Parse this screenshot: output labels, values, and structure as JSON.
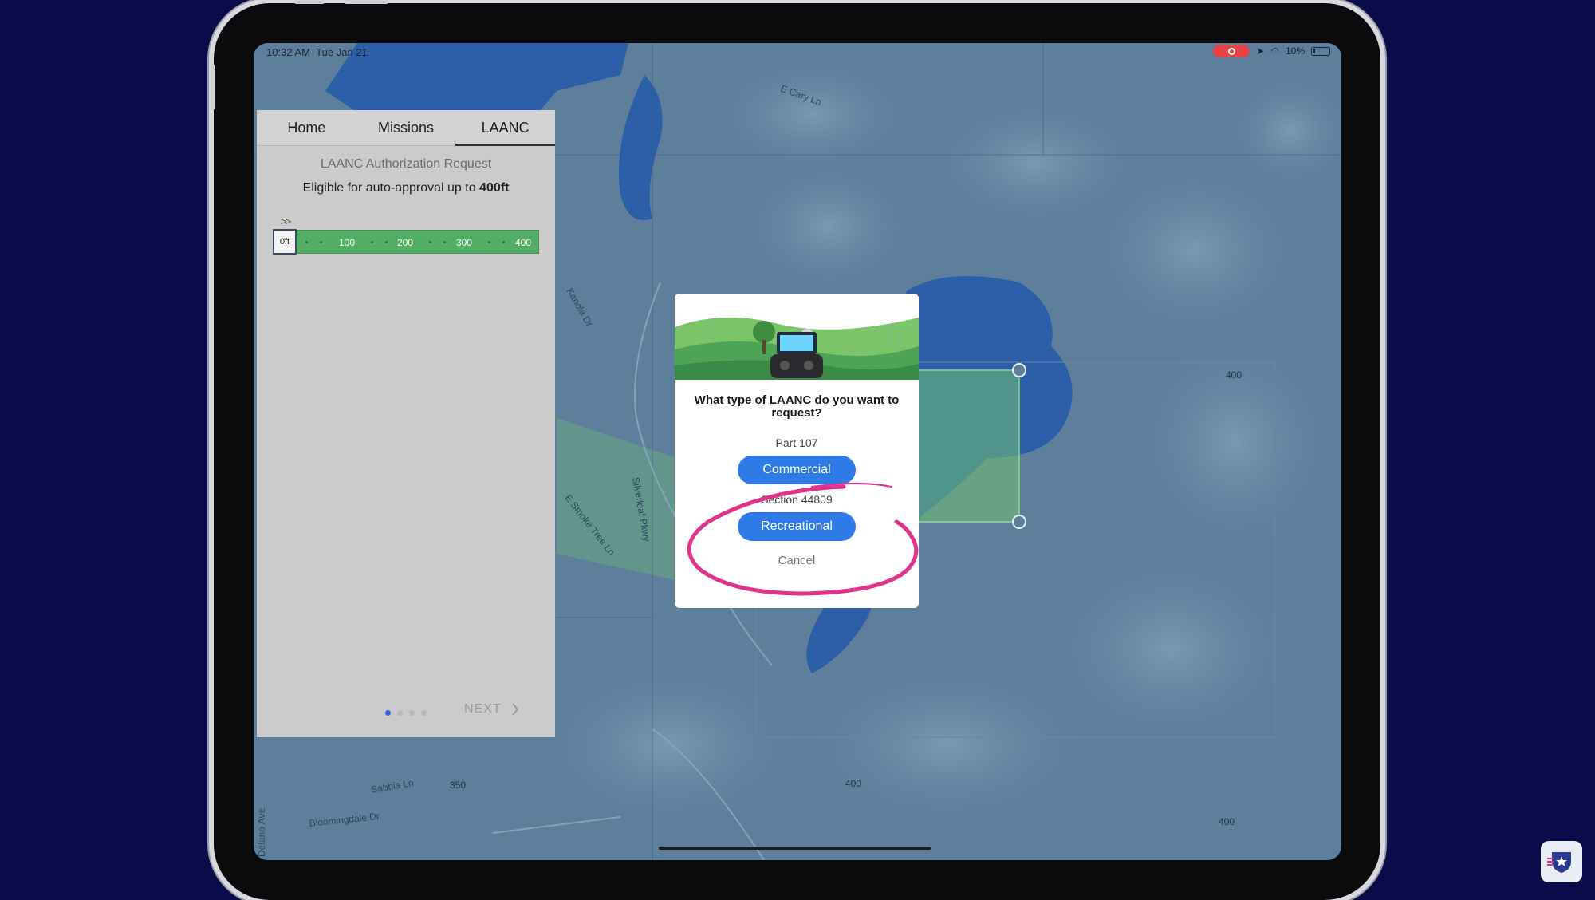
{
  "status_bar": {
    "time": "10:32 AM",
    "date": "Tue Jan 21",
    "battery": "10%",
    "icons": [
      "screen-record-icon",
      "location-arrow-icon",
      "wifi-icon",
      "battery-icon"
    ]
  },
  "tabs": [
    {
      "label": "Home",
      "active": false
    },
    {
      "label": "Missions",
      "active": false
    },
    {
      "label": "LAANC",
      "active": true
    }
  ],
  "panel": {
    "title": "LAANC Authorization Request",
    "eligible_prefix": "Eligible for auto-approval up to ",
    "eligible_value": "400ft",
    "arrows": ">>",
    "altitude": {
      "handle_label": "0ft",
      "ticks": [
        "100",
        "200",
        "300",
        "400"
      ],
      "max": 400,
      "current": 0,
      "color": "#51ae64"
    },
    "pager": {
      "total": 4,
      "current": 1
    },
    "next_label": "NEXT"
  },
  "modal": {
    "question": "What type of LAANC do you want to request?",
    "part107_label": "Part 107",
    "commercial_label": "Commercial",
    "section_label": "Section 44809",
    "recreational_label": "Recreational",
    "cancel_label": "Cancel",
    "highlight_color": "#e0338a",
    "button_color": "#2e7ae6"
  },
  "map": {
    "roads": [
      "E Cary Ln",
      "Kanola Dr",
      "E Smoke Tree Ln",
      "Silverleaf Pkwy",
      "Sabbia Ln",
      "Bloomingdale Dr",
      "Delano Ave"
    ],
    "altitude_labels": [
      "400",
      "400",
      "350",
      "400"
    ],
    "water_color": "#2c5fa8",
    "land_color": "#5d7f9c",
    "zone_color": "#6fbf73"
  },
  "badge_icon": "shield-star-icon"
}
